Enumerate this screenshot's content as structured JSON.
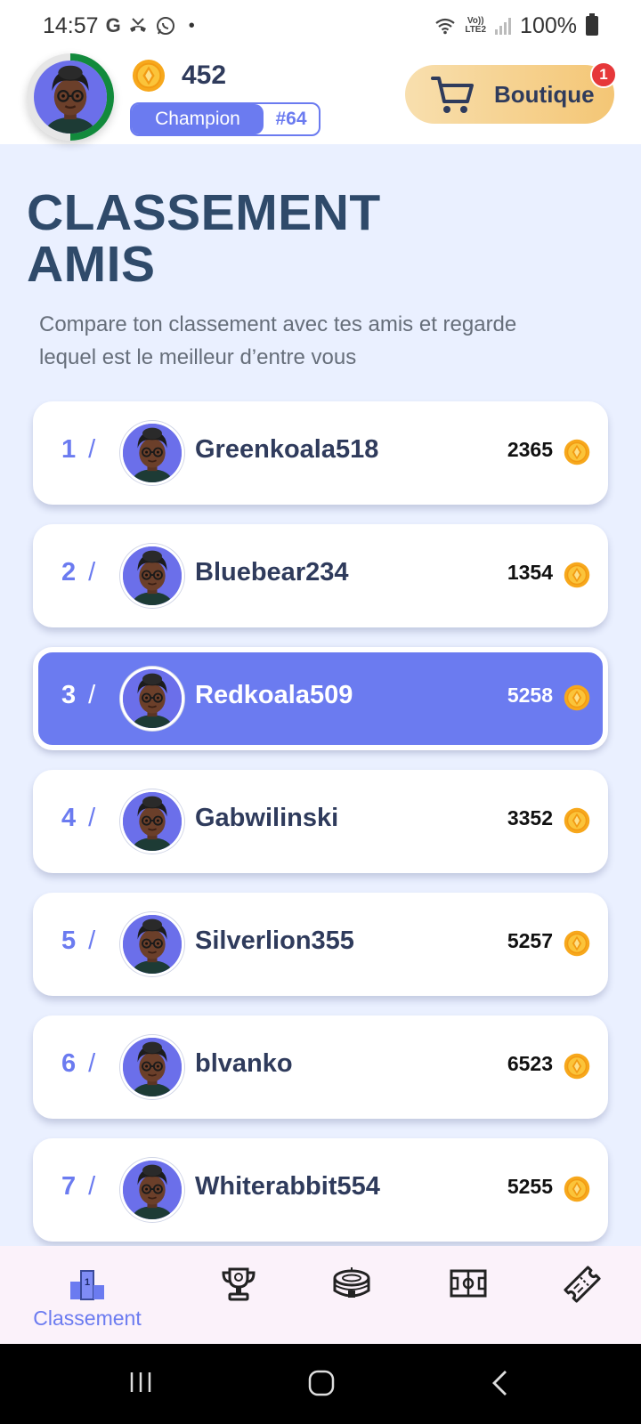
{
  "status_bar": {
    "time": "14:57",
    "lte_top": "Vo))",
    "lte_bottom": "LTE2",
    "battery": "100%"
  },
  "header": {
    "coins": "452",
    "rank_label": "Champion",
    "rank_number": "#64",
    "shop_label": "Boutique",
    "shop_badge": "1"
  },
  "page": {
    "title_line1": "CLASSEMENT",
    "title_line2": "AMIS",
    "subtitle": "Compare ton classement avec tes amis et regarde lequel est le meilleur d’entre vous"
  },
  "leaderboard": [
    {
      "rank": "1",
      "name": "Greenkoala518",
      "points": "2365"
    },
    {
      "rank": "2",
      "name": "Bluebear234",
      "points": "1354"
    },
    {
      "rank": "3",
      "name": "Redkoala509",
      "points": "5258"
    },
    {
      "rank": "4",
      "name": "Gabwilinski",
      "points": "3352"
    },
    {
      "rank": "5",
      "name": "Silverlion355",
      "points": "5257"
    },
    {
      "rank": "6",
      "name": "blvanko",
      "points": "6523"
    },
    {
      "rank": "7",
      "name": "Whiterabbit554",
      "points": "5255"
    }
  ],
  "slash": "/",
  "bottom_nav": {
    "items": [
      {
        "icon": "podium-icon",
        "label": "Classement",
        "active": true
      },
      {
        "icon": "trophy-icon",
        "label": ""
      },
      {
        "icon": "stadium-icon",
        "label": ""
      },
      {
        "icon": "field-icon",
        "label": ""
      },
      {
        "icon": "ticket-icon",
        "label": ""
      }
    ]
  },
  "colors": {
    "accent": "#6b7bf0",
    "title": "#2f4a6a",
    "background": "#eaf0ff",
    "badge": "#e6383a",
    "progress_ring": "#128a3c"
  }
}
